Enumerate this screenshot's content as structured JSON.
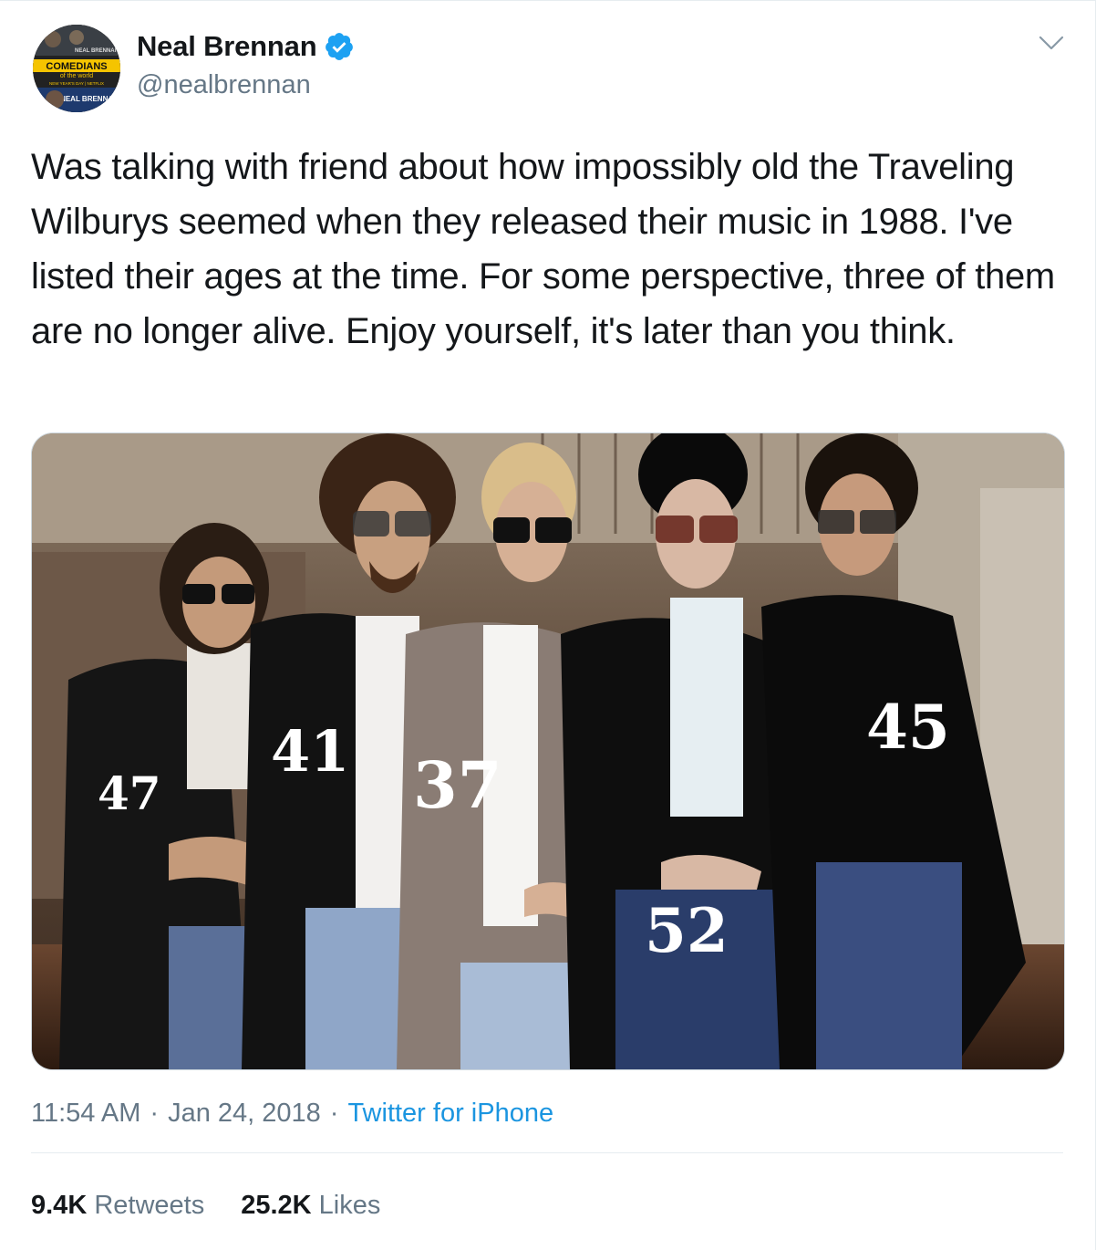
{
  "author": {
    "name": "Neal Brennan",
    "handle": "@nealbrennan",
    "avatar_text": {
      "top": "NEAL BRENNAN",
      "title": "COMEDIANS",
      "subtitle": "of the world",
      "banner": "NEW YEAR'S DAY | NETFLIX",
      "bottom": "NEAL BRENNAN"
    }
  },
  "tweet": {
    "text": "Was talking with friend about how impossibly old the Traveling Wilburys seemed when they released their music in 1988. I've listed their ages at the time. For some perspective, three of them are no longer alive. Enjoy yourself, it's later than you think."
  },
  "media": {
    "ages": [
      "47",
      "41",
      "37",
      "52",
      "45"
    ]
  },
  "meta": {
    "time": "11:54 AM",
    "date": "Jan 24, 2018",
    "separator": "·",
    "source": "Twitter for iPhone"
  },
  "stats": {
    "retweets_count": "9.4K",
    "retweets_label": "Retweets",
    "likes_count": "25.2K",
    "likes_label": "Likes"
  },
  "colors": {
    "link": "#1b95e0",
    "secondary_text": "#657786",
    "verified": "#1da1f2"
  },
  "icons": {
    "verified": "verified-badge-icon",
    "menu": "chevron-down-icon"
  }
}
